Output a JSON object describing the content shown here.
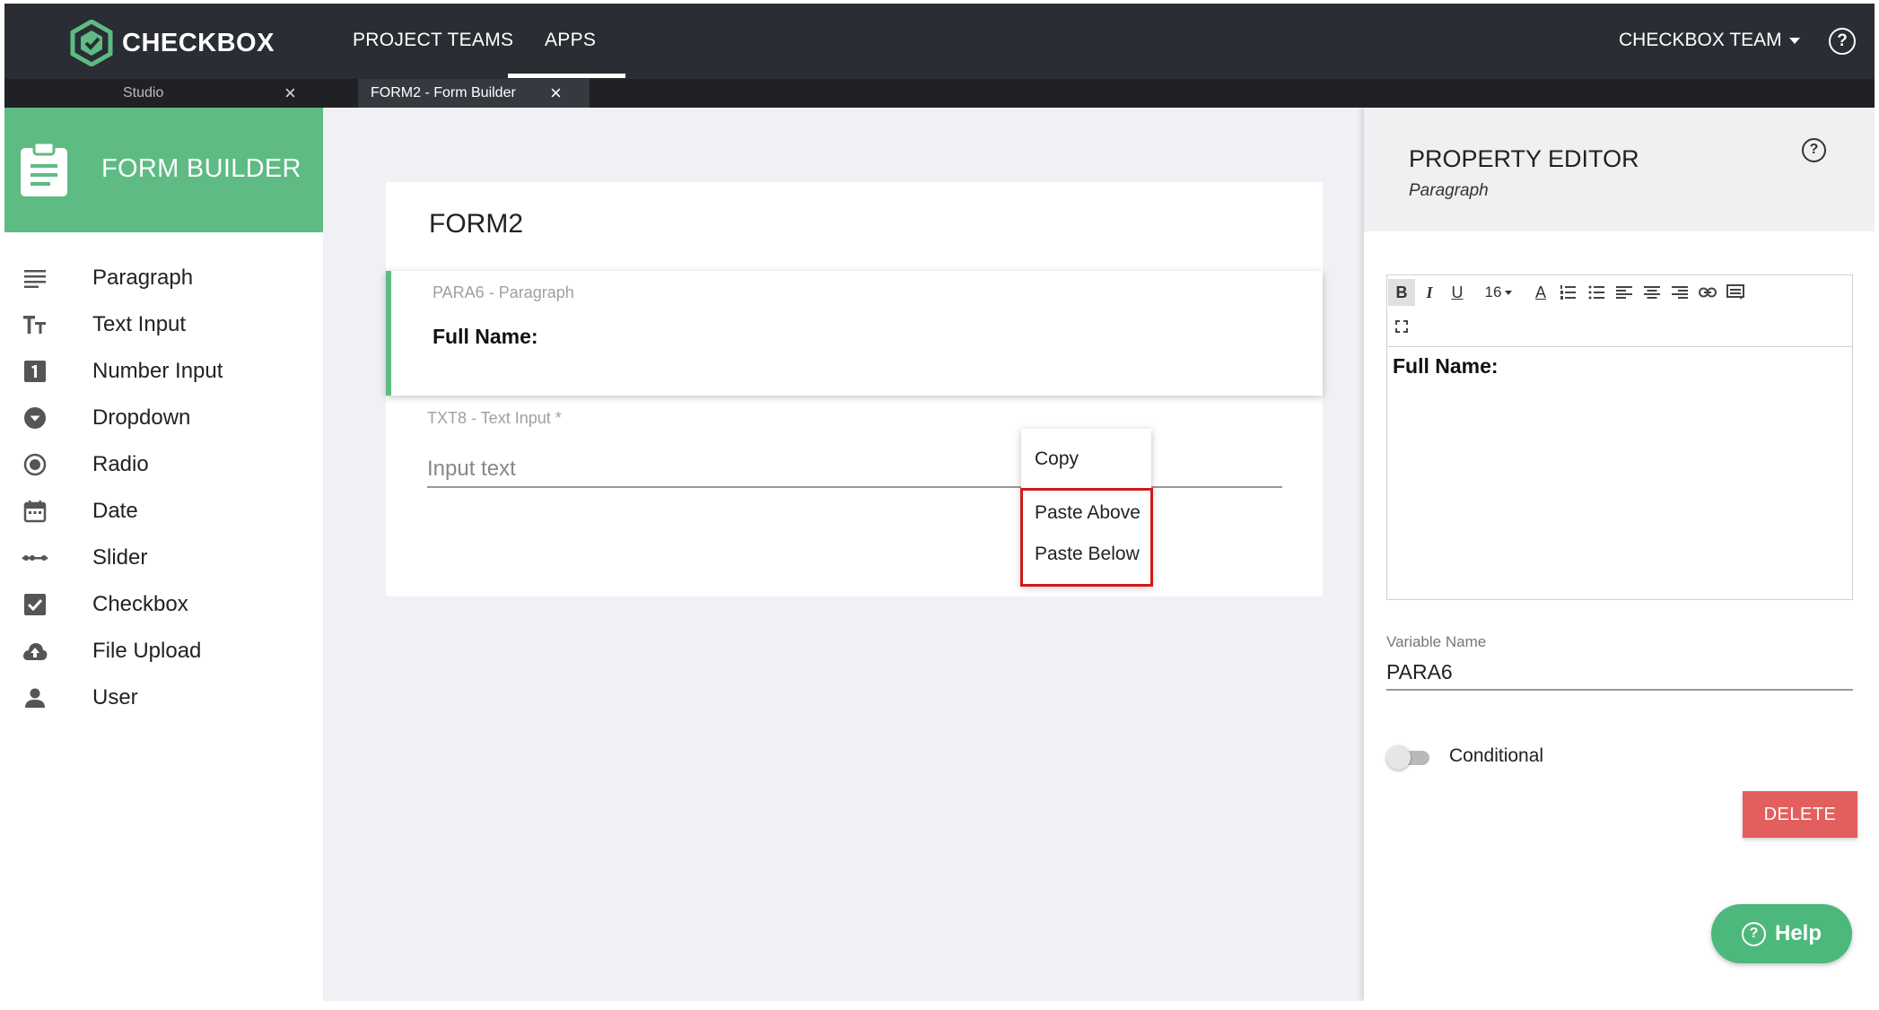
{
  "topbar": {
    "brand": "CHECKBOX",
    "nav": {
      "projects": "PROJECT TEAMS",
      "apps": "APPS"
    },
    "team_menu": "CHECKBOX TEAM",
    "help_glyph": "?"
  },
  "tabs": [
    {
      "label": "Studio",
      "close": "×"
    },
    {
      "label": "FORM2 - Form Builder",
      "close": "×"
    }
  ],
  "sidebar": {
    "title": "FORM BUILDER",
    "items": [
      {
        "label": "Paragraph",
        "icon": "paragraph-icon"
      },
      {
        "label": "Text Input",
        "icon": "text-size-icon"
      },
      {
        "label": "Number Input",
        "icon": "number-one-icon"
      },
      {
        "label": "Dropdown",
        "icon": "dropdown-circle-icon"
      },
      {
        "label": "Radio",
        "icon": "radio-icon"
      },
      {
        "label": "Date",
        "icon": "calendar-icon"
      },
      {
        "label": "Slider",
        "icon": "slider-icon"
      },
      {
        "label": "Checkbox",
        "icon": "checkbox-icon"
      },
      {
        "label": "File Upload",
        "icon": "cloud-upload-icon"
      },
      {
        "label": "User",
        "icon": "person-icon"
      }
    ]
  },
  "form": {
    "title": "FORM2",
    "paragraph": {
      "meta": "PARA6 - Paragraph",
      "text": "Full Name:"
    },
    "text_input": {
      "meta": "TXT8 - Text Input *",
      "placeholder": "Input text"
    }
  },
  "context_menu": {
    "copy": "Copy",
    "paste_above": "Paste Above",
    "paste_below": "Paste Below"
  },
  "property_editor": {
    "title": "PROPERTY EDITOR",
    "subtitle": "Paragraph",
    "help_glyph": "?",
    "toolbar": {
      "bold": "B",
      "italic": "I",
      "underline": "U",
      "font_size": "16",
      "font_color": "A"
    },
    "content": "Full Name:",
    "variable_name_label": "Variable Name",
    "variable_name_value": "PARA6",
    "conditional_label": "Conditional",
    "conditional_on": false,
    "delete_label": "DELETE"
  },
  "help_button": {
    "label": "Help",
    "glyph": "?"
  },
  "colors": {
    "brand_green": "#5dbb83",
    "topbar": "#2a2d33",
    "delete_red": "#e35f5d",
    "highlight_red": "#d11a1a",
    "help_green": "#4db87c"
  }
}
